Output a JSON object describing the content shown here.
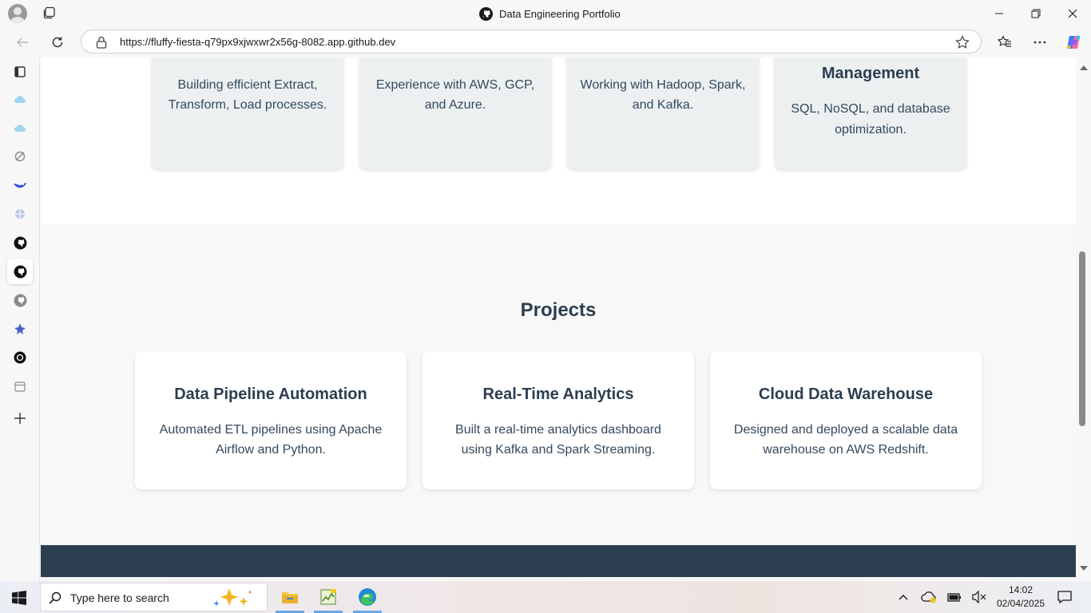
{
  "browser": {
    "window_title": "Data Engineering Portfolio",
    "url": "https://fluffy-fiesta-q79px9xjwxwr2x56g-8082.app.github.dev"
  },
  "skills": [
    {
      "title": "",
      "description": "Building efficient Extract, Transform, Load processes."
    },
    {
      "title": "",
      "description": "Experience with AWS, GCP, and Azure."
    },
    {
      "title": "",
      "description": "Working with Hadoop, Spark, and Kafka."
    },
    {
      "title": "Management",
      "description": "SQL, NoSQL, and database optimization."
    }
  ],
  "projects": {
    "heading": "Projects",
    "items": [
      {
        "title": "Data Pipeline Automation",
        "description": "Automated ETL pipelines using Apache Airflow and Python."
      },
      {
        "title": "Real-Time Analytics",
        "description": "Built a real-time analytics dashboard using Kafka and Spark Streaming."
      },
      {
        "title": "Cloud Data Warehouse",
        "description": "Designed and deployed a scalable data warehouse on AWS Redshift."
      }
    ]
  },
  "taskbar": {
    "search_placeholder": "Type here to search",
    "time": "14:02",
    "date": "02/04/2025"
  },
  "scrollbar": {
    "position_fraction": 0.57
  },
  "colors": {
    "footer": "#2c3e50",
    "card": "#ecf0f1",
    "accent_text": "#2c3e50"
  }
}
